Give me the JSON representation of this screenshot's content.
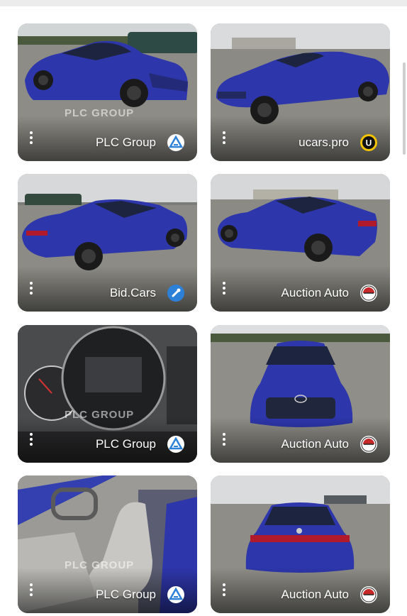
{
  "listings": [
    {
      "source": "PLC Group",
      "logo": "plc-group-logo",
      "watermark": "PLC GROUP"
    },
    {
      "source": "ucars.pro",
      "logo": "ucars-logo",
      "logo_letter": "U"
    },
    {
      "source": "Bid.Cars",
      "logo": "bidcars-logo"
    },
    {
      "source": "Auction Auto",
      "logo": "auction-auto-logo"
    },
    {
      "source": "PLC Group",
      "logo": "plc-group-logo",
      "watermark": "PLC GROUP"
    },
    {
      "source": "Auction Auto",
      "logo": "auction-auto-logo"
    },
    {
      "source": "PLC Group",
      "logo": "plc-group-logo",
      "watermark": "PLC GROUP"
    },
    {
      "source": "Auction Auto",
      "logo": "auction-auto-logo"
    }
  ],
  "photos": [
    "blue sedan front three-quarter view",
    "blue sedan front side view",
    "blue sedan rear side view",
    "blue sedan side view",
    "instrument cluster",
    "blue sedan front view",
    "interior front seats",
    "blue sedan rear view"
  ],
  "colors": {
    "car_blue": "#2c35a8",
    "lot_gray": "#8d8c86",
    "sky": "#d7d9db",
    "badge_blue": "#2c80d8",
    "badge_red": "#c62828"
  }
}
